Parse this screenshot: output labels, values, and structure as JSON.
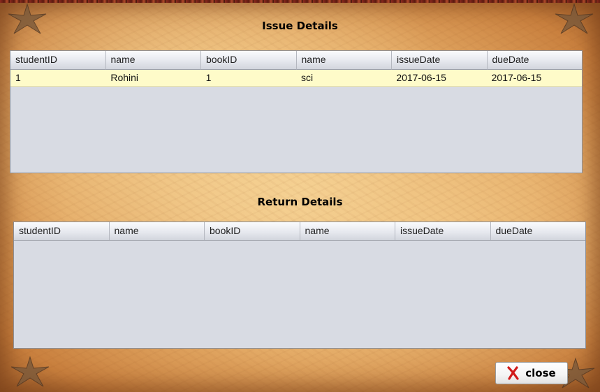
{
  "issue_section": {
    "title": "Issue Details",
    "columns": [
      "studentID",
      "name",
      "bookID",
      "name",
      "issueDate",
      "dueDate"
    ],
    "rows": [
      [
        "1",
        "Rohini",
        "1",
        "sci",
        "2017-06-15",
        "2017-06-15"
      ]
    ]
  },
  "return_section": {
    "title": "Return Details",
    "columns": [
      "studentID",
      "name",
      "bookID",
      "name",
      "issueDate",
      "dueDate"
    ],
    "rows": []
  },
  "close_button": {
    "label": "close",
    "icon": "close-x-icon"
  },
  "colors": {
    "table_background": "#d8dbe3",
    "selected_row": "#fefbc9",
    "close_icon": "#d11a1a",
    "parchment": "#e3a964"
  }
}
